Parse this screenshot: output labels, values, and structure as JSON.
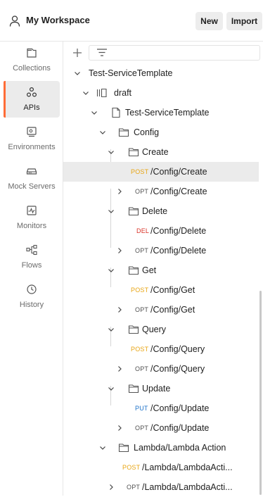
{
  "header": {
    "workspace_title": "My Workspace",
    "workspace_icon": "user-icon",
    "new_label": "New",
    "import_label": "Import"
  },
  "sidebar": {
    "items": [
      {
        "label": "Collections",
        "icon": "collections-icon",
        "active": false
      },
      {
        "label": "APIs",
        "icon": "apis-icon",
        "active": true
      },
      {
        "label": "Environments",
        "icon": "environments-icon",
        "active": false
      },
      {
        "label": "Mock Servers",
        "icon": "mock-servers-icon",
        "active": false
      },
      {
        "label": "Monitors",
        "icon": "monitors-icon",
        "active": false
      },
      {
        "label": "Flows",
        "icon": "flows-icon",
        "active": false
      },
      {
        "label": "History",
        "icon": "history-icon",
        "active": false
      }
    ]
  },
  "toolbar": {
    "add_icon": "plus-icon",
    "filter_icon": "filter-icon"
  },
  "colors": {
    "accent": "#ff6c37",
    "post": "#e8a513",
    "delete": "#d93025",
    "put": "#1e73c9",
    "options": "#505050"
  },
  "tree": [
    {
      "label": "Test-ServiceTemplate"
    },
    {
      "label": "draft"
    },
    {
      "label": "Test-ServiceTemplate"
    },
    {
      "label": "Config"
    },
    {
      "label": "Create"
    },
    {
      "method": "POST",
      "label": "/Config/Create"
    },
    {
      "method": "OPT",
      "label": "/Config/Create"
    },
    {
      "label": "Delete"
    },
    {
      "method": "DEL",
      "label": "/Config/Delete"
    },
    {
      "method": "OPT",
      "label": "/Config/Delete"
    },
    {
      "label": "Get"
    },
    {
      "method": "POST",
      "label": "/Config/Get"
    },
    {
      "method": "OPT",
      "label": "/Config/Get"
    },
    {
      "label": "Query"
    },
    {
      "method": "POST",
      "label": "/Config/Query"
    },
    {
      "method": "OPT",
      "label": "/Config/Query"
    },
    {
      "label": "Update"
    },
    {
      "method": "PUT",
      "label": "/Config/Update"
    },
    {
      "method": "OPT",
      "label": "/Config/Update"
    },
    {
      "label": "Lambda/Lambda Action"
    },
    {
      "method": "POST",
      "label": "/Lambda/LambdaActi..."
    },
    {
      "method": "OPT",
      "label": "/Lambda/LambdaActi..."
    }
  ]
}
